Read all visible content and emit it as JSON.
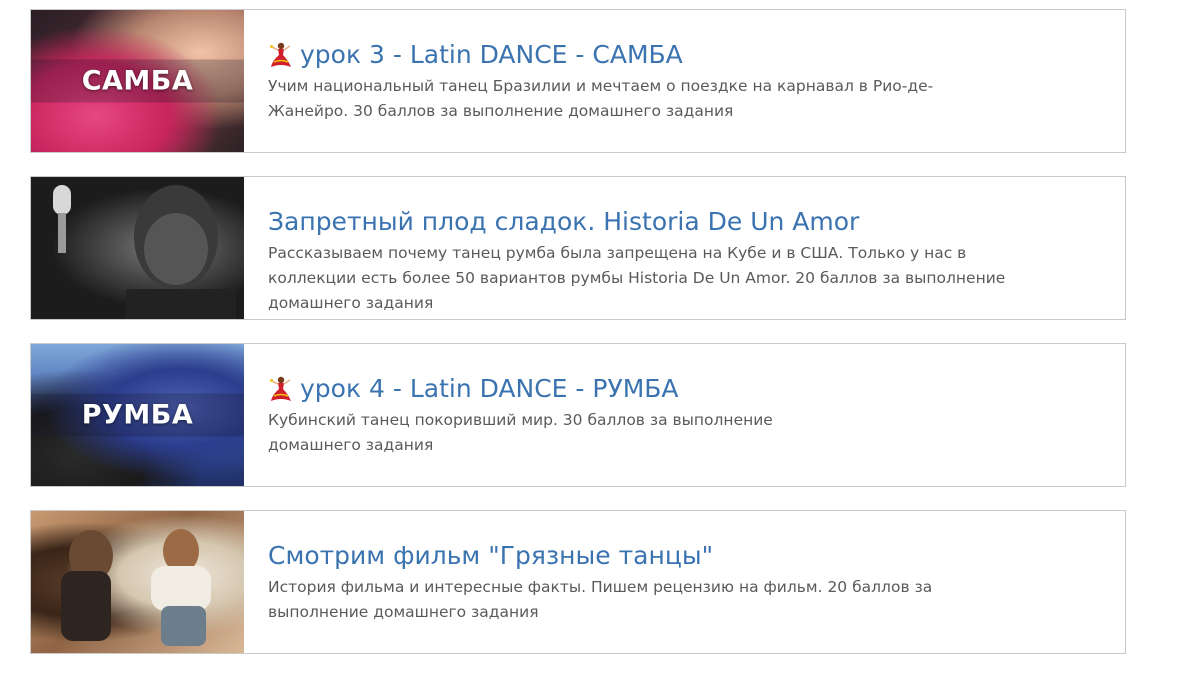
{
  "cards": [
    {
      "thumb_label": "САМБА",
      "has_icon": true,
      "icon": "dancer-icon",
      "title": "урок 3 - Latin DANCE - САМБА",
      "description": "Учим национальный танец Бразилии и мечтаем о поездке на карнавал в Рио-де-Жанейро. 30 баллов за выполнение домашнего задания"
    },
    {
      "thumb_label": "",
      "has_icon": false,
      "title": "Запретный плод сладок. Historia De Un Amor",
      "description": "Рассказываем почему танец румба была запрещена на Кубе и в США. Только у нас в коллекции есть более 50 вариантов румбы Historia De Un Amor. 20 баллов за выполнение домашнего задания"
    },
    {
      "thumb_label": "РУМБА",
      "has_icon": true,
      "icon": "dancer-icon",
      "title": "урок 4 - Latin DANCE - РУМБА",
      "description": "Кубинский танец покоривший мир. 30 баллов за выполнение домашнего задания"
    },
    {
      "thumb_label": "",
      "has_icon": false,
      "title": "Смотрим фильм \"Грязные танцы\"",
      "description": "История фильма и интересные факты. Пишем рецензию на фильм. 20 баллов за выполнение домашнего задания"
    }
  ],
  "colors": {
    "title": "#3a73b0",
    "text": "#5a5a5a",
    "border": "#c9c9c9"
  }
}
